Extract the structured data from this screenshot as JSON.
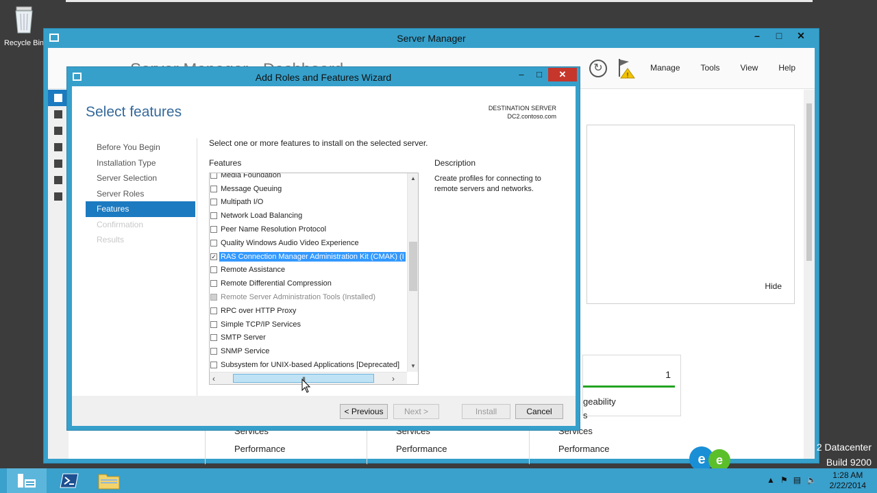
{
  "desktop": {
    "recycle_bin_label": "Recycle Bin",
    "watermark_line1": "2 Datacenter",
    "watermark_line2": "Build 9200"
  },
  "server_manager": {
    "title": "Server Manager",
    "breadcrumb": "Server Manager • Dashboard",
    "menu": [
      "Manage",
      "Tools",
      "View",
      "Help"
    ],
    "hide_label": "Hide",
    "tile_count": "1",
    "tile_manageability": "geability",
    "tile_services_partial": "s",
    "tile_col_services": "Services",
    "tile_col_performance": "Performance",
    "accent": "#36a0cb"
  },
  "wizard": {
    "title": "Add Roles and Features Wizard",
    "heading": "Select features",
    "destination_label": "DESTINATION SERVER",
    "destination_server": "DC2.contoso.com",
    "instruction": "Select one or more features to install on the selected server.",
    "features_label": "Features",
    "description_label": "Description",
    "description_text": "Create profiles for connecting to remote servers and networks.",
    "steps": [
      {
        "label": "Before You Begin",
        "state": "normal"
      },
      {
        "label": "Installation Type",
        "state": "normal"
      },
      {
        "label": "Server Selection",
        "state": "normal"
      },
      {
        "label": "Server Roles",
        "state": "normal"
      },
      {
        "label": "Features",
        "state": "active"
      },
      {
        "label": "Confirmation",
        "state": "disabled"
      },
      {
        "label": "Results",
        "state": "disabled"
      }
    ],
    "features": [
      {
        "label": "Media Foundation",
        "checked": false
      },
      {
        "label": "Message Queuing",
        "checked": false
      },
      {
        "label": "Multipath I/O",
        "checked": false
      },
      {
        "label": "Network Load Balancing",
        "checked": false
      },
      {
        "label": "Peer Name Resolution Protocol",
        "checked": false
      },
      {
        "label": "Quality Windows Audio Video Experience",
        "checked": false
      },
      {
        "label": "RAS Connection Manager Administration Kit (CMAK) (I",
        "checked": true,
        "selected": true
      },
      {
        "label": "Remote Assistance",
        "checked": false
      },
      {
        "label": "Remote Differential Compression",
        "checked": false
      },
      {
        "label": "Remote Server Administration Tools (Installed)",
        "checked": "partial",
        "grey": true
      },
      {
        "label": "RPC over HTTP Proxy",
        "checked": false
      },
      {
        "label": "Simple TCP/IP Services",
        "checked": false
      },
      {
        "label": "SMTP Server",
        "checked": false
      },
      {
        "label": "SNMP Service",
        "checked": false
      },
      {
        "label": "Subsystem for UNIX-based Applications [Deprecated]",
        "checked": false
      }
    ],
    "buttons": {
      "previous": "< Previous",
      "next": "Next >",
      "install": "Install",
      "cancel": "Cancel"
    }
  },
  "taskbar": {
    "time": "1:28 AM",
    "date": "2/22/2014"
  }
}
